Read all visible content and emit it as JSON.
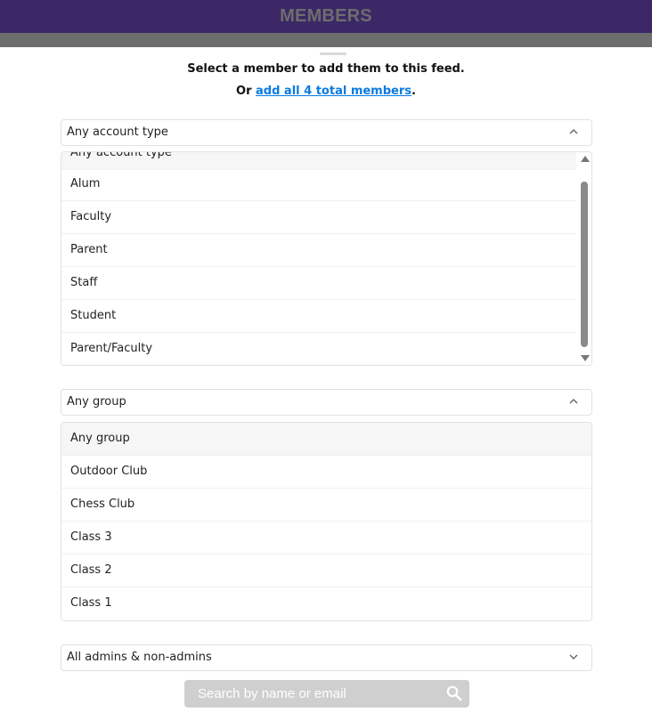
{
  "header": {
    "title": "MEMBERS"
  },
  "instructions": {
    "line1": "Select a member to add them to this feed.",
    "line2_prefix": "Or ",
    "line2_link": "add all 4 total members",
    "line2_suffix": "."
  },
  "account_type_select": {
    "value": "Any account type",
    "options": [
      "Any account type",
      "Alum",
      "Faculty",
      "Parent",
      "Staff",
      "Student",
      "Parent/Faculty"
    ]
  },
  "group_select": {
    "value": "Any group",
    "options": [
      "Any group",
      "Outdoor Club",
      "Chess Club",
      "Class 3",
      "Class 2",
      "Class 1"
    ]
  },
  "admin_select": {
    "value": "All admins & non-admins"
  },
  "search": {
    "placeholder": "Search by name or email"
  },
  "icons": {
    "chevron_up": "chevron-up-icon",
    "chevron_down": "chevron-down-icon",
    "search": "search-icon"
  },
  "colors": {
    "header_bg": "#3c2866",
    "link": "#0a7be0",
    "search_bg": "#cfcfcf"
  }
}
